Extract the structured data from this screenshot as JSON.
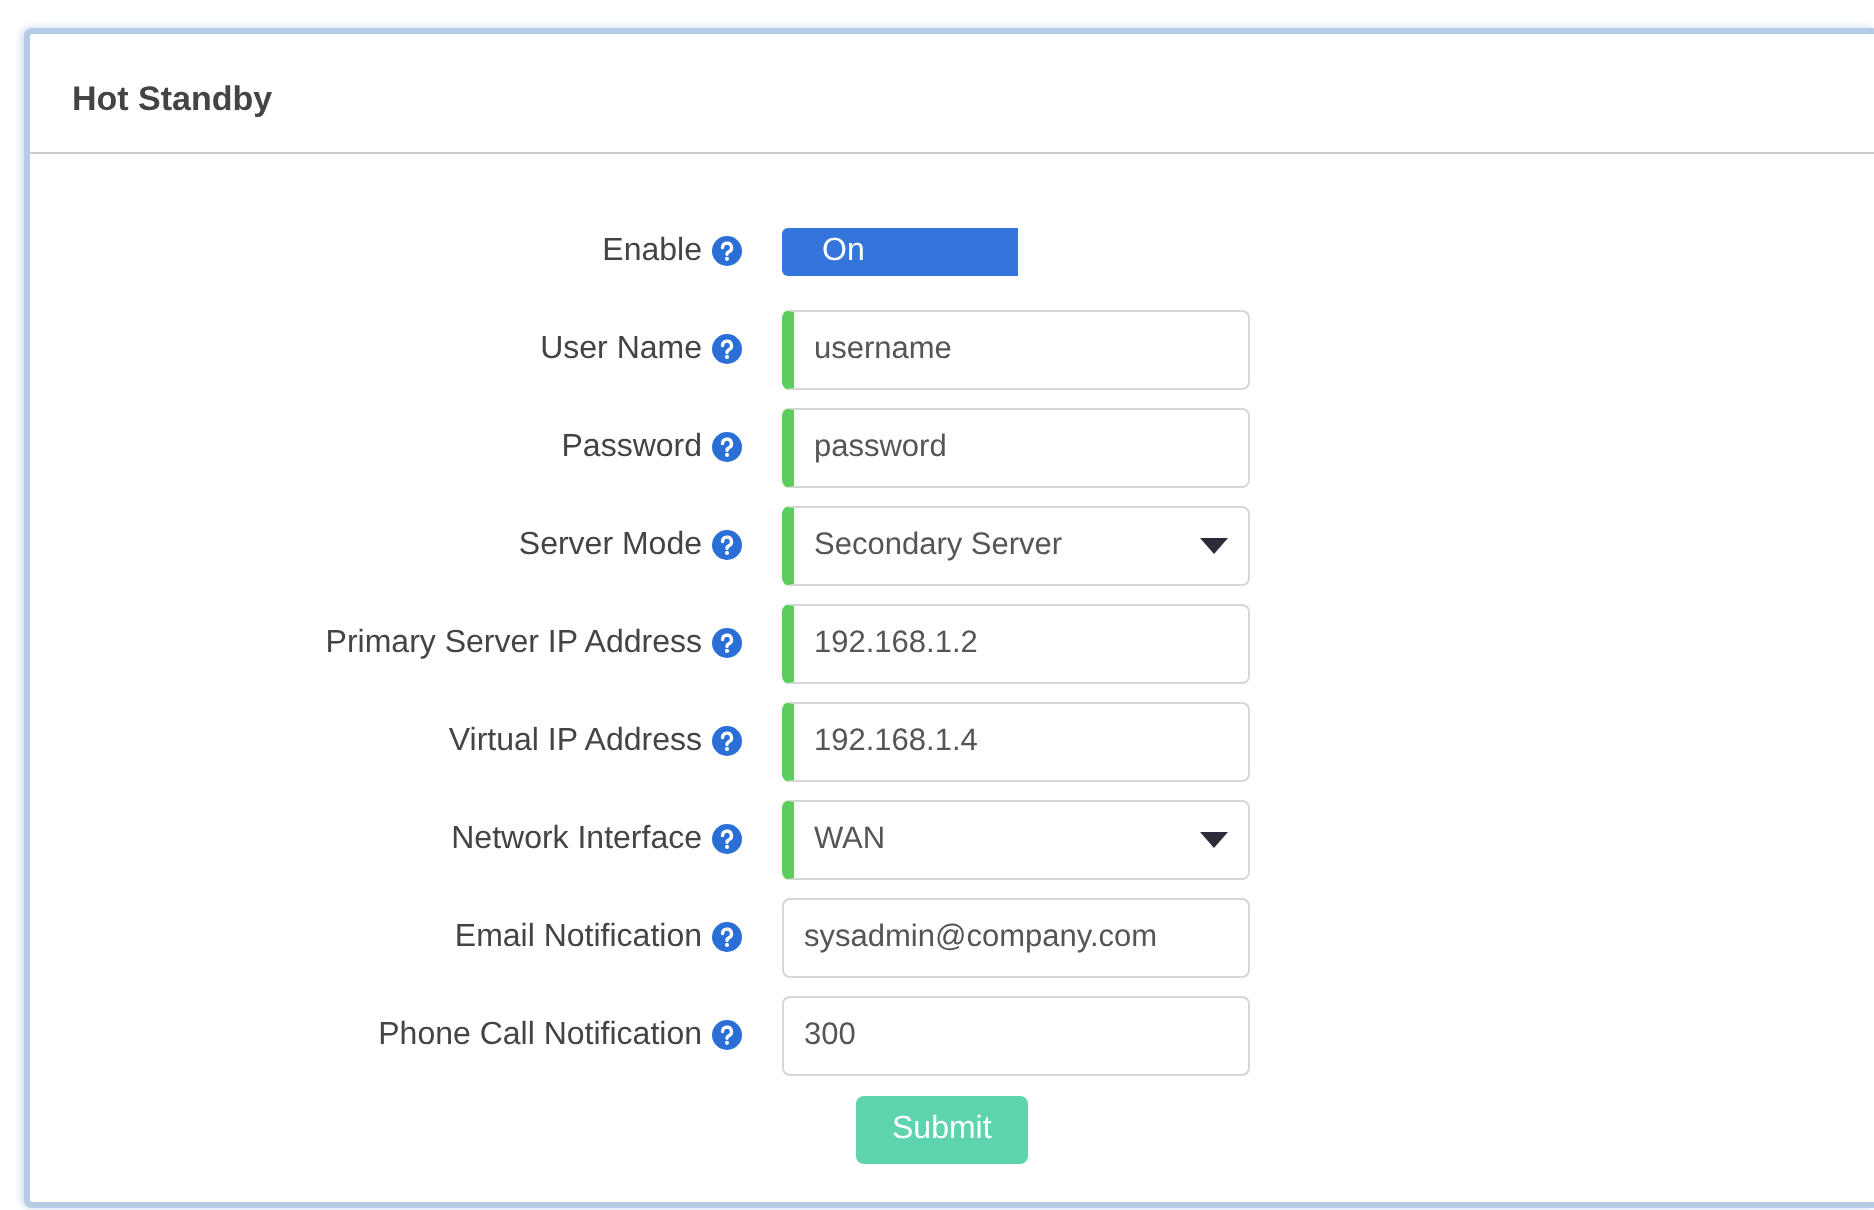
{
  "panel": {
    "title": "Hot Standby"
  },
  "toggle": {
    "label": "Enable",
    "on": true,
    "on_text": "On"
  },
  "fields": [
    {
      "label": "User Name",
      "kind": "text",
      "value": "username",
      "required": true
    },
    {
      "label": "Password",
      "kind": "text",
      "value": "password",
      "required": true
    },
    {
      "label": "Server Mode",
      "kind": "select",
      "value": "Secondary Server",
      "required": true
    },
    {
      "label": "Primary Server IP Address",
      "kind": "text",
      "value": "192.168.1.2",
      "required": true
    },
    {
      "label": "Virtual IP Address",
      "kind": "text",
      "value": "192.168.1.4",
      "required": true
    },
    {
      "label": "Network Interface",
      "kind": "select",
      "value": "WAN",
      "required": true
    },
    {
      "label": "Email Notification",
      "kind": "text",
      "value": "sysadmin@company.com",
      "required": false
    },
    {
      "label": "Phone Call Notification",
      "kind": "text",
      "value": "300",
      "required": false
    }
  ],
  "submit": {
    "label": "Submit"
  }
}
